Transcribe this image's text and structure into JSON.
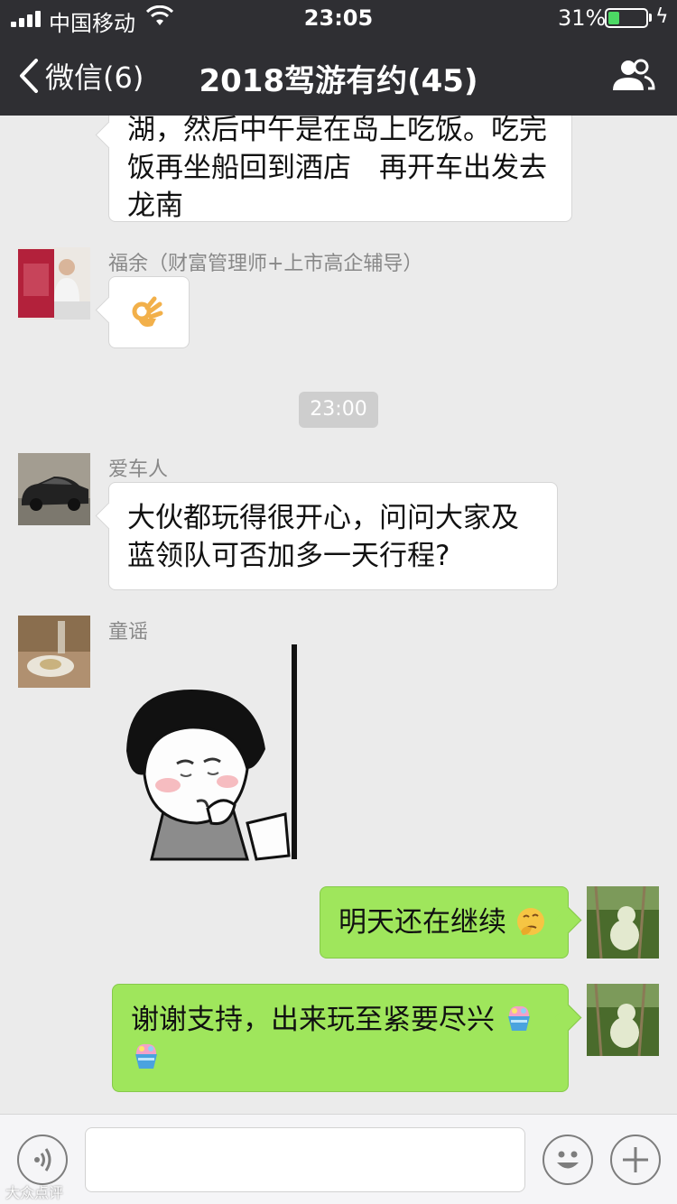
{
  "status_bar": {
    "carrier": "中国移动",
    "time": "23:05",
    "battery_percent": "31%",
    "battery_level": 0.31,
    "battery_color": "#4cd964"
  },
  "nav": {
    "back_label": "微信(6)",
    "title": "2018驾游有约(45)",
    "members_icon": "people-icon"
  },
  "messages": [
    {
      "side": "in",
      "text": "湖，然后中午是在岛上吃饭。吃完饭再坐船回到酒店　再开车出发去龙南"
    },
    {
      "side": "in",
      "sender": "福余（财富管理师+上市高企辅导）",
      "emoji": "ok-hand-emoji"
    },
    {
      "type": "time",
      "text": "23:00"
    },
    {
      "side": "in",
      "sender": "爱车人",
      "text": "大伙都玩得很开心，问问大家及蓝领队可否加多一天行程?"
    },
    {
      "side": "in",
      "sender": "童谣",
      "sticker": "peeking-sticker"
    },
    {
      "side": "out",
      "text": "明天还在继续",
      "emoji": "thinking-emoji"
    },
    {
      "side": "out",
      "text": "谢谢支持，出来玩至紧要尽兴",
      "emoji": "shaved-ice-emoji"
    }
  ],
  "input_bar": {
    "voice_icon": "voice-icon",
    "emoji_icon": "smiley-icon",
    "plus_icon": "plus-icon"
  },
  "watermark": "大众点评"
}
